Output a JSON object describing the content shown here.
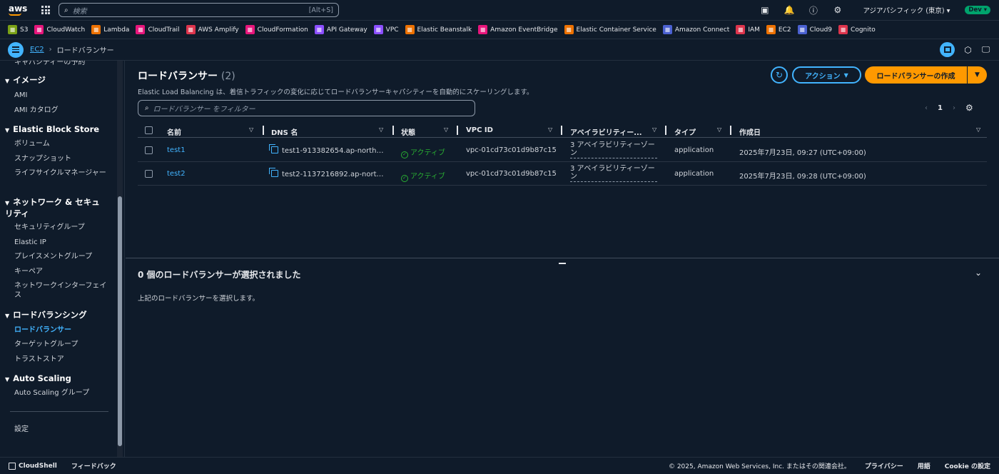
{
  "topbar": {
    "logo": "aws",
    "search_placeholder": "検索",
    "search_shortcut": "[Alt+S]",
    "region": "アジアパシフィック (東京) ▾",
    "account_badge": "Dev ▾"
  },
  "favorites": [
    {
      "label": "S3",
      "color": "#7aa116"
    },
    {
      "label": "CloudWatch",
      "color": "#e7157b"
    },
    {
      "label": "Lambda",
      "color": "#ed7100"
    },
    {
      "label": "CloudTrail",
      "color": "#e7157b"
    },
    {
      "label": "AWS Amplify",
      "color": "#dd344c"
    },
    {
      "label": "CloudFormation",
      "color": "#e7157b"
    },
    {
      "label": "API Gateway",
      "color": "#8c4fff"
    },
    {
      "label": "VPC",
      "color": "#8c4fff"
    },
    {
      "label": "Elastic Beanstalk",
      "color": "#ed7100"
    },
    {
      "label": "Amazon EventBridge",
      "color": "#e7157b"
    },
    {
      "label": "Elastic Container Service",
      "color": "#ed7100"
    },
    {
      "label": "Amazon Connect",
      "color": "#4b61d1"
    },
    {
      "label": "IAM",
      "color": "#dd344c"
    },
    {
      "label": "EC2",
      "color": "#ed7100"
    },
    {
      "label": "Cloud9",
      "color": "#4b61d1"
    },
    {
      "label": "Cognito",
      "color": "#dd344c"
    }
  ],
  "breadcrumb": {
    "service": "EC2",
    "current": "ロードバランサー"
  },
  "sidebar": {
    "items": [
      {
        "label": "キャパシティーの予約",
        "type": "item"
      },
      {
        "label": "イメージ",
        "type": "head"
      },
      {
        "label": "AMI",
        "type": "item"
      },
      {
        "label": "AMI カタログ",
        "type": "item"
      },
      {
        "label": "Elastic Block Store",
        "type": "head"
      },
      {
        "label": "ボリューム",
        "type": "item"
      },
      {
        "label": "スナップショット",
        "type": "item"
      },
      {
        "label": "ライフサイクルマネージャー",
        "type": "item"
      },
      {
        "label": "ネットワーク & セキュリティ",
        "type": "head"
      },
      {
        "label": "セキュリティグループ",
        "type": "item"
      },
      {
        "label": "Elastic IP",
        "type": "item"
      },
      {
        "label": "プレイスメントグループ",
        "type": "item"
      },
      {
        "label": "キーペア",
        "type": "item"
      },
      {
        "label": "ネットワークインターフェイス",
        "type": "item"
      },
      {
        "label": "ロードバランシング",
        "type": "head"
      },
      {
        "label": "ロードバランサー",
        "type": "active"
      },
      {
        "label": "ターゲットグループ",
        "type": "item"
      },
      {
        "label": "トラストストア",
        "type": "item"
      },
      {
        "label": "Auto Scaling",
        "type": "head"
      },
      {
        "label": "Auto Scaling グループ",
        "type": "item"
      },
      {
        "label": "設定",
        "type": "item"
      }
    ]
  },
  "main": {
    "title": "ロードバランサー",
    "count": "(2)",
    "description": "Elastic Load Balancing は、着信トラフィックの変化に応じてロードバランサーキャパシティーを自動的にスケーリングします。",
    "filter_placeholder": "ロードバランサー をフィルター",
    "action_label": "アクション",
    "create_label": "ロードバランサーの作成",
    "page": "1",
    "columns": [
      "名前",
      "DNS 名",
      "状態",
      "VPC ID",
      "アベイラビリティー...",
      "タイプ",
      "作成日"
    ],
    "rows": [
      {
        "name": "test1",
        "dns": "test1-913382654.ap-north…",
        "state": "アクティブ",
        "vpc": "vpc-01cd73c01d9b87c15",
        "az": "3 アベイラビリティーゾーン",
        "type": "application",
        "created": "2025年7月23日, 09:27 (UTC+09:00)"
      },
      {
        "name": "test2",
        "dns": "test2-1137216892.ap-nort…",
        "state": "アクティブ",
        "vpc": "vpc-01cd73c01d9b87c15",
        "az": "3 アベイラビリティーゾーン",
        "type": "application",
        "created": "2025年7月23日, 09:28 (UTC+09:00)"
      }
    ],
    "selection_title": "0 個のロードバランサーが選択されました",
    "selection_desc": "上記のロードバランサーを選択します。"
  },
  "footer": {
    "cloudshell": "CloudShell",
    "feedback": "フィードバック",
    "copyright": "© 2025, Amazon Web Services, Inc. またはその関連会社。",
    "privacy": "プライバシー",
    "terms": "用語",
    "cookie": "Cookie の設定"
  }
}
